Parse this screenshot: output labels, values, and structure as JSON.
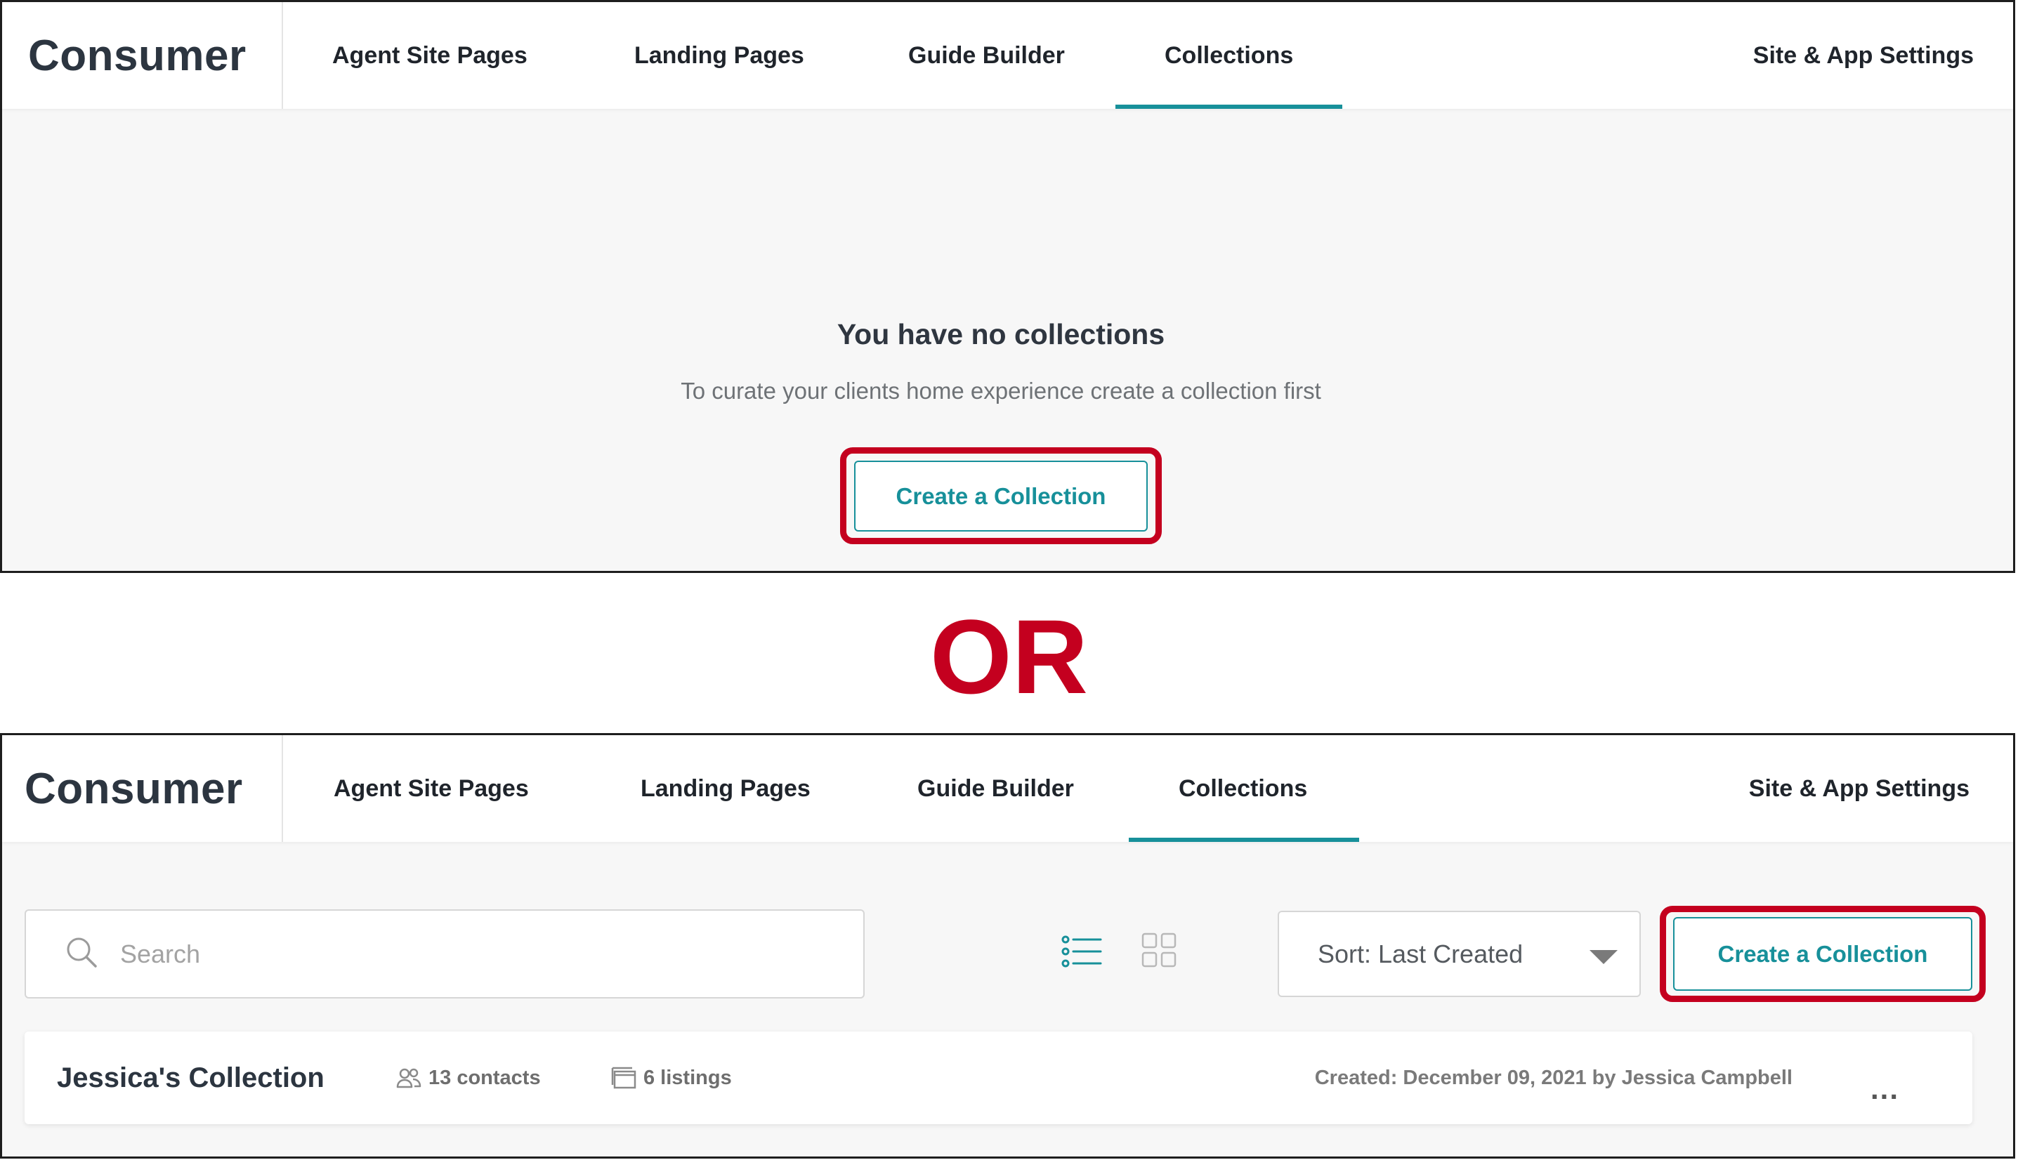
{
  "colors": {
    "accent": "#17909a",
    "highlight": "#c4001f",
    "text": "#2c3540",
    "muted": "#6b6f73",
    "background": "#f7f7f7"
  },
  "icons": {
    "search": "search-icon",
    "list_view": "list-view-icon",
    "grid_view": "grid-view-icon",
    "sort_caret": "chevron-down-icon",
    "contacts": "contacts-icon",
    "listings": "listings-icon",
    "more": "more-icon"
  },
  "top_panel": {
    "brand": "Consumer",
    "nav": [
      {
        "label": "Agent Site Pages",
        "active": false
      },
      {
        "label": "Landing Pages",
        "active": false
      },
      {
        "label": "Guide Builder",
        "active": false
      },
      {
        "label": "Collections",
        "active": true
      }
    ],
    "settings_label": "Site & App Settings",
    "empty_state": {
      "title": "You have no collections",
      "subtitle": "To curate your clients home experience create a collection first",
      "button_label": "Create a Collection"
    }
  },
  "separator_label": "OR",
  "bottom_panel": {
    "brand": "Consumer",
    "nav": [
      {
        "label": "Agent Site Pages",
        "active": false
      },
      {
        "label": "Landing Pages",
        "active": false
      },
      {
        "label": "Guide Builder",
        "active": false
      },
      {
        "label": "Collections",
        "active": true
      }
    ],
    "settings_label": "Site & App Settings",
    "toolbar": {
      "search_placeholder": "Search",
      "list_view_selected": true,
      "grid_view_selected": false,
      "sort_label": "Sort: Last Created",
      "create_button_label": "Create a Collection"
    },
    "collections": [
      {
        "name": "Jessica's Collection",
        "contacts": "13 contacts",
        "listings": "6 listings",
        "created": "Created: December 09, 2021 by Jessica Campbell",
        "menu_label": "..."
      }
    ]
  }
}
